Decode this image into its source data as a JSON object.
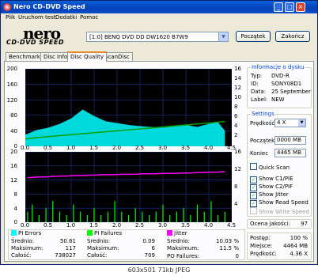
{
  "window": {
    "title": "Nero CD-DVD Speed"
  },
  "menu": [
    "Plik",
    "Uruchom test",
    "Dodatki",
    "Pomoc"
  ],
  "logo": {
    "word": "nero",
    "sub": "CD·DVD SPEED"
  },
  "drive": {
    "selected": "[1:0]  BENQ DVD DD DW1620 B7W9"
  },
  "buttons": {
    "start": "Początek",
    "end": "Zakończ"
  },
  "tabs": [
    "Benchmark",
    "Disc Info",
    "Disc Quality",
    "ScanDisc"
  ],
  "active_tab": "Disc Quality",
  "chart_data": [
    {
      "type": "area",
      "name": "PI Errors",
      "ylim_left": [
        0,
        200
      ],
      "ylim_right": [
        0,
        16
      ],
      "xlim": [
        0,
        4.5
      ],
      "yticks_left": [
        "200",
        "160",
        "120",
        "80",
        "40",
        "0"
      ],
      "yticks_right": [
        "16",
        "14",
        "12",
        "10",
        "8",
        "6",
        "4",
        "2"
      ],
      "xticks": [
        "0.0",
        "0.5",
        "1.0",
        "1.5",
        "2.0",
        "2.5",
        "3.0",
        "3.5",
        "4.0",
        "4.5"
      ],
      "x": [
        0.0,
        0.25,
        0.5,
        0.75,
        1.0,
        1.25,
        1.5,
        1.75,
        2.0,
        2.25,
        2.5,
        2.75,
        3.0,
        3.25,
        3.5,
        3.75,
        4.0,
        4.2,
        4.35
      ],
      "pi_values": [
        30,
        42,
        48,
        58,
        72,
        95,
        78,
        65,
        60,
        55,
        52,
        50,
        48,
        52,
        55,
        50,
        58,
        62,
        40
      ],
      "speed_values": [
        1.5,
        1.8,
        2.0,
        2.2,
        2.4,
        2.6,
        2.8,
        3.0,
        3.2,
        3.4,
        3.6,
        3.8,
        4.0,
        4.2,
        4.4,
        4.6,
        4.8,
        5.0,
        5.1
      ],
      "colors": {
        "pi": "#00ffff",
        "speed": "#00a000",
        "background": "#000000",
        "grid": "#1f3fbf"
      }
    },
    {
      "type": "bar",
      "name": "PI Failures",
      "ylim_left": [
        0,
        20
      ],
      "ylim_right": [
        0,
        16
      ],
      "xlim": [
        0,
        4.5
      ],
      "yticks_left": [
        "20",
        "16",
        "12",
        "8",
        "4",
        "0"
      ],
      "yticks_right": [
        "16",
        "12",
        "8",
        "4"
      ],
      "xticks": [
        "0.0",
        "0.5",
        "1.0",
        "1.5",
        "2.0",
        "2.5",
        "3.0",
        "3.5",
        "4.0",
        "4.5"
      ],
      "x": [
        0.05,
        0.15,
        0.3,
        0.45,
        0.6,
        0.75,
        0.9,
        1.05,
        1.2,
        1.35,
        1.5,
        1.65,
        1.8,
        1.95,
        2.1,
        2.25,
        2.4,
        2.55,
        2.7,
        2.85,
        3.0,
        3.15,
        3.3,
        3.45,
        3.6,
        3.75,
        3.9,
        4.05,
        4.2,
        4.35
      ],
      "pif_values": [
        3,
        5,
        2,
        4,
        6,
        3,
        2,
        5,
        3,
        2,
        4,
        2,
        3,
        6,
        3,
        2,
        4,
        3,
        2,
        3,
        5,
        2,
        3,
        4,
        2,
        5,
        3,
        6,
        2,
        3
      ],
      "jitter_values": [
        10.1,
        10.2,
        10.3,
        10.3,
        10.4,
        10.5,
        10.5,
        10.6,
        10.6,
        10.7,
        10.7,
        10.8,
        10.8,
        10.8,
        10.9,
        10.9,
        10.9,
        11.0,
        11.0,
        11.0,
        11.1,
        11.1,
        11.1,
        11.2,
        11.2,
        11.3,
        11.3,
        11.4,
        11.4,
        11.5
      ],
      "colors": {
        "pif": "#00ff00",
        "jitter": "#ff00ff",
        "background": "#000000",
        "grid": "#1f3fbf"
      }
    }
  ],
  "disc_info": {
    "title": "Informacje o dysku",
    "rows": [
      {
        "label": "Typ:",
        "value": "DVD-R"
      },
      {
        "label": "ID:",
        "value": "SONY08D1"
      },
      {
        "label": "Data:",
        "value": "25 September"
      },
      {
        "label": "Label:",
        "value": "NEW"
      }
    ]
  },
  "settings": {
    "title": "Settings",
    "speed_label": "Prędkość",
    "speed_value": "4 X",
    "start_label": "Początek",
    "start_value": "0000 MB",
    "end_label": "Koniec",
    "end_value": "4465 MB",
    "quick_scan": "Quick Scan",
    "checks": [
      {
        "label": "Show C1/PIE",
        "checked": true,
        "enabled": true
      },
      {
        "label": "Show C2/PIF",
        "checked": true,
        "enabled": true
      },
      {
        "label": "Show Jitter",
        "checked": true,
        "enabled": true
      },
      {
        "label": "Show Read Speed",
        "checked": true,
        "enabled": true
      },
      {
        "label": "Show Write Speed",
        "checked": false,
        "enabled": false
      }
    ]
  },
  "quality": {
    "label": "Ocena jakości:",
    "value": "97"
  },
  "progress": {
    "rows": [
      {
        "label": "Postęp:",
        "value": "100 %"
      },
      {
        "label": "Miejsce:",
        "value": "4464 MB"
      },
      {
        "label": "Prędkość:",
        "value": "4.36 X"
      }
    ]
  },
  "stats": {
    "pi_errors": {
      "title": "PI Errors",
      "color": "#00ffff",
      "rows": [
        {
          "label": "Średnio:",
          "value": "50.61"
        },
        {
          "label": "Maksimum:",
          "value": "117"
        },
        {
          "label": "Całość:",
          "value": "738027"
        }
      ]
    },
    "pi_failures": {
      "title": "PI Failures",
      "color": "#00ff00",
      "rows": [
        {
          "label": "Średnio:",
          "value": "0.09"
        },
        {
          "label": "Maksimum:",
          "value": "6"
        },
        {
          "label": "Całość:",
          "value": "709"
        }
      ]
    },
    "jitter": {
      "title": "Jitter",
      "color": "#ff00ff",
      "rows": [
        {
          "label": "Średnio:",
          "value": "10.03 %"
        },
        {
          "label": "Maksimum:",
          "value": "11.5 %"
        }
      ]
    },
    "po_failures": {
      "label": "PO Failures:",
      "value": "0"
    }
  },
  "caption": "603x501 71kb JPEG"
}
